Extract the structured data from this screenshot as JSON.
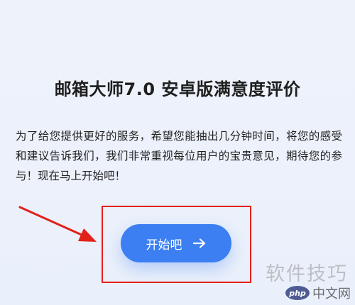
{
  "page": {
    "title": "邮箱大师7.0 安卓版满意度评价",
    "intro_text": "为了给您提供更好的服务，希望您能抽出几分钟时间，将您的感受和建议告诉我们，我们非常重视每位用户的宝贵意见，期待您的参与！现在马上开始吧！",
    "start_button_label": "开始吧"
  },
  "icons": {
    "start_button_icon": "arrow-right-icon"
  },
  "watermark": {
    "text": "软件技巧",
    "logo_badge": "php",
    "logo_site": "中文网"
  },
  "colors": {
    "background": "#ecf1fb",
    "button": "#3b7ff2",
    "annotation": "#e3211b"
  }
}
